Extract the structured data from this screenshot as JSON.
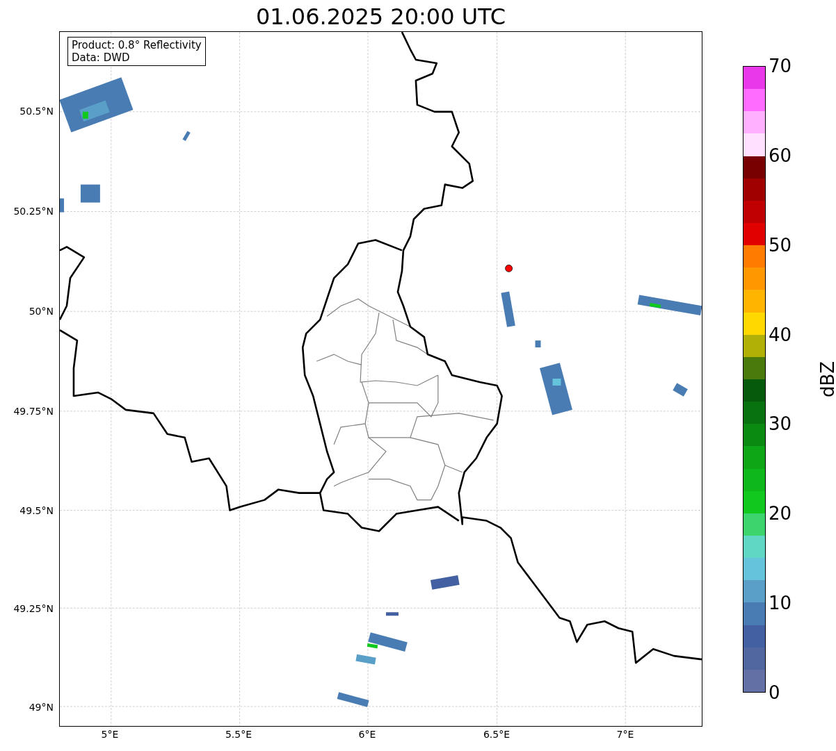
{
  "title": "01.06.2025 20:00 UTC",
  "info_box": [
    "Product: 0.8° Reflectivity",
    "Data: DWD"
  ],
  "lat_ticks": [
    "50.5°N",
    "50.25°N",
    "50°N",
    "49.75°N",
    "49.5°N",
    "49.25°N",
    "49°N"
  ],
  "lon_ticks": [
    "5°E",
    "5.5°E",
    "6°E",
    "6.5°E",
    "7°E"
  ],
  "colorbar": {
    "label": "dBZ",
    "ticks": [
      "70",
      "60",
      "50",
      "40",
      "30",
      "20",
      "10",
      "0"
    ],
    "bins": [
      {
        "color": "#6370a6"
      },
      {
        "color": "#51679f"
      },
      {
        "color": "#4360a2"
      },
      {
        "color": "#4a7cb4"
      },
      {
        "color": "#5a9fc8"
      },
      {
        "color": "#66c3dc"
      },
      {
        "color": "#60d6c4"
      },
      {
        "color": "#3cd46c"
      },
      {
        "color": "#10c81e"
      },
      {
        "color": "#0eb81a"
      },
      {
        "color": "#0ea616"
      },
      {
        "color": "#0b8a12"
      },
      {
        "color": "#08730e"
      },
      {
        "color": "#055a0c"
      },
      {
        "color": "#4a7a0b"
      },
      {
        "color": "#b0b007"
      },
      {
        "color": "#ffd800"
      },
      {
        "color": "#ffb400"
      },
      {
        "color": "#ff9800"
      },
      {
        "color": "#ff7c00"
      },
      {
        "color": "#e00000"
      },
      {
        "color": "#c00000"
      },
      {
        "color": "#a00000"
      },
      {
        "color": "#780000"
      },
      {
        "color": "#ffe0ff"
      },
      {
        "color": "#ffb0ff"
      },
      {
        "color": "#ff6cff"
      },
      {
        "color": "#e838e8"
      }
    ]
  }
}
